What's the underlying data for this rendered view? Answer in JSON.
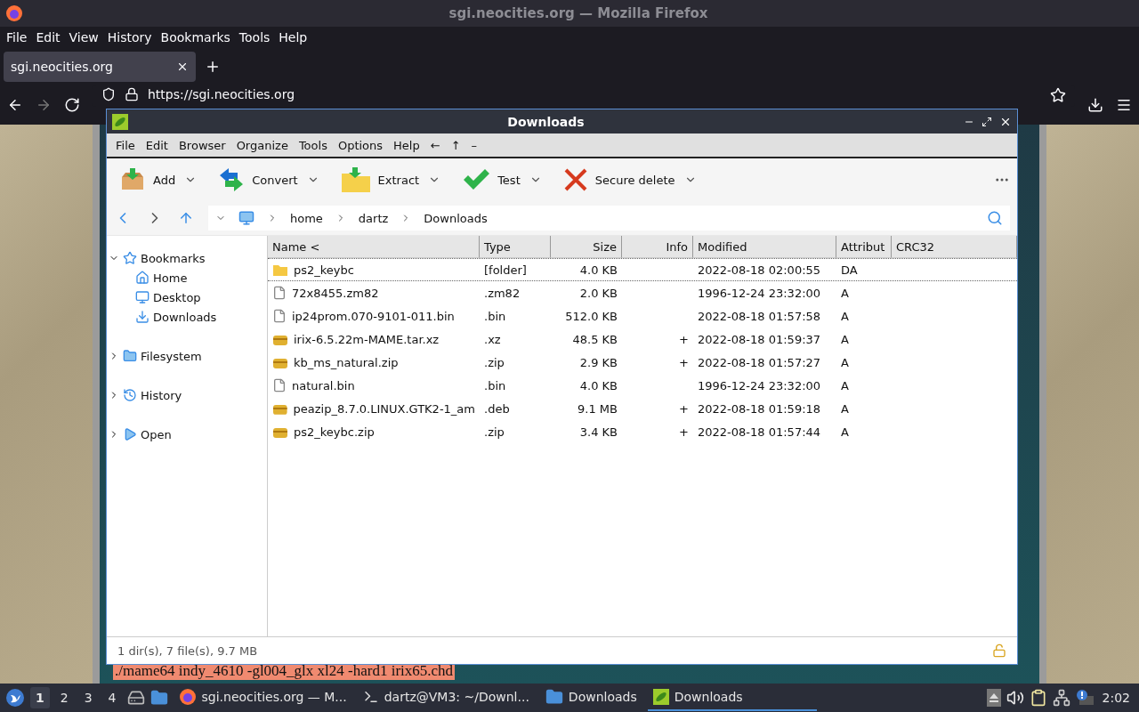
{
  "firefox": {
    "title": "sgi.neocities.org — Mozilla Firefox",
    "menu": [
      "File",
      "Edit",
      "View",
      "History",
      "Bookmarks",
      "Tools",
      "Help"
    ],
    "tabs": [
      {
        "label": "sgi.neocities.org",
        "selected": true
      }
    ],
    "url": "https://sgi.neocities.org"
  },
  "page": {
    "command": "./mame64 indy_4610 -gl004_glx xl24 -hard1 irix65.chd"
  },
  "peazip": {
    "title": "Downloads",
    "menu": [
      "File",
      "Edit",
      "Browser",
      "Organize",
      "Tools",
      "Options",
      "Help",
      "←",
      "↑",
      "–"
    ],
    "toolbar": [
      {
        "kind": "add",
        "label": "Add"
      },
      {
        "kind": "convert",
        "label": "Convert"
      },
      {
        "kind": "extract",
        "label": "Extract"
      },
      {
        "kind": "test",
        "label": "Test"
      },
      {
        "kind": "delete",
        "label": "Secure delete"
      }
    ],
    "breadcrumb": [
      "home",
      "dartz",
      "Downloads"
    ],
    "tree": [
      {
        "label": "Bookmarks",
        "kind": "star",
        "expanded": true,
        "children": [
          {
            "label": "Home",
            "kind": "home"
          },
          {
            "label": "Desktop",
            "kind": "desktop"
          },
          {
            "label": "Downloads",
            "kind": "download"
          }
        ]
      },
      {
        "label": "Filesystem",
        "kind": "folder",
        "expanded": false
      },
      {
        "label": "History",
        "kind": "history",
        "expanded": false
      },
      {
        "label": "Open",
        "kind": "open",
        "expanded": false
      }
    ],
    "columns": [
      "Name <",
      "Type",
      "Size",
      "Info",
      "Modified",
      "Attribut",
      "CRC32"
    ],
    "rows": [
      {
        "kind": "folder",
        "name": "ps2_keybc",
        "type": "[folder]",
        "size": "4.0 KB",
        "info": "",
        "modified": "2022-08-18 02:00:55",
        "attr": "DA",
        "selected": true
      },
      {
        "kind": "file",
        "name": "72x8455.zm82",
        "type": ".zm82",
        "size": "2.0 KB",
        "info": "",
        "modified": "1996-12-24 23:32:00",
        "attr": "A",
        "selected": false
      },
      {
        "kind": "file",
        "name": "ip24prom.070-9101-011.bin",
        "type": ".bin",
        "size": "512.0 KB",
        "info": "",
        "modified": "2022-08-18 01:57:58",
        "attr": "A",
        "selected": false
      },
      {
        "kind": "archive",
        "name": "irix-6.5.22m-MAME.tar.xz",
        "type": ".xz",
        "size": "48.5 KB",
        "info": "+",
        "modified": "2022-08-18 01:59:37",
        "attr": "A",
        "selected": false
      },
      {
        "kind": "archive",
        "name": "kb_ms_natural.zip",
        "type": ".zip",
        "size": "2.9 KB",
        "info": "+",
        "modified": "2022-08-18 01:57:27",
        "attr": "A",
        "selected": false
      },
      {
        "kind": "file",
        "name": "natural.bin",
        "type": ".bin",
        "size": "4.0 KB",
        "info": "",
        "modified": "1996-12-24 23:32:00",
        "attr": "A",
        "selected": false
      },
      {
        "kind": "archive",
        "name": "peazip_8.7.0.LINUX.GTK2-1_am",
        "type": ".deb",
        "size": "9.1 MB",
        "info": "+",
        "modified": "2022-08-18 01:59:18",
        "attr": "A",
        "selected": false
      },
      {
        "kind": "archive",
        "name": "ps2_keybc.zip",
        "type": ".zip",
        "size": "3.4 KB",
        "info": "+",
        "modified": "2022-08-18 01:57:44",
        "attr": "A",
        "selected": false
      }
    ],
    "status": "1 dir(s), 7 file(s), 9.7 MB"
  },
  "taskbar": {
    "workspaces": [
      {
        "label": "1",
        "selected": true
      },
      {
        "label": "2",
        "selected": false
      },
      {
        "label": "3",
        "selected": false
      },
      {
        "label": "4",
        "selected": false
      }
    ],
    "tasks": [
      {
        "kind": "firefox",
        "label": "sgi.neocities.org — M...",
        "selected": false
      },
      {
        "kind": "terminal",
        "label": "dartz@VM3: ~/Downl...",
        "selected": false
      },
      {
        "kind": "folder",
        "label": "Downloads",
        "selected": false
      },
      {
        "kind": "peazip",
        "label": "Downloads",
        "selected": true
      }
    ],
    "clock": "2:02"
  }
}
